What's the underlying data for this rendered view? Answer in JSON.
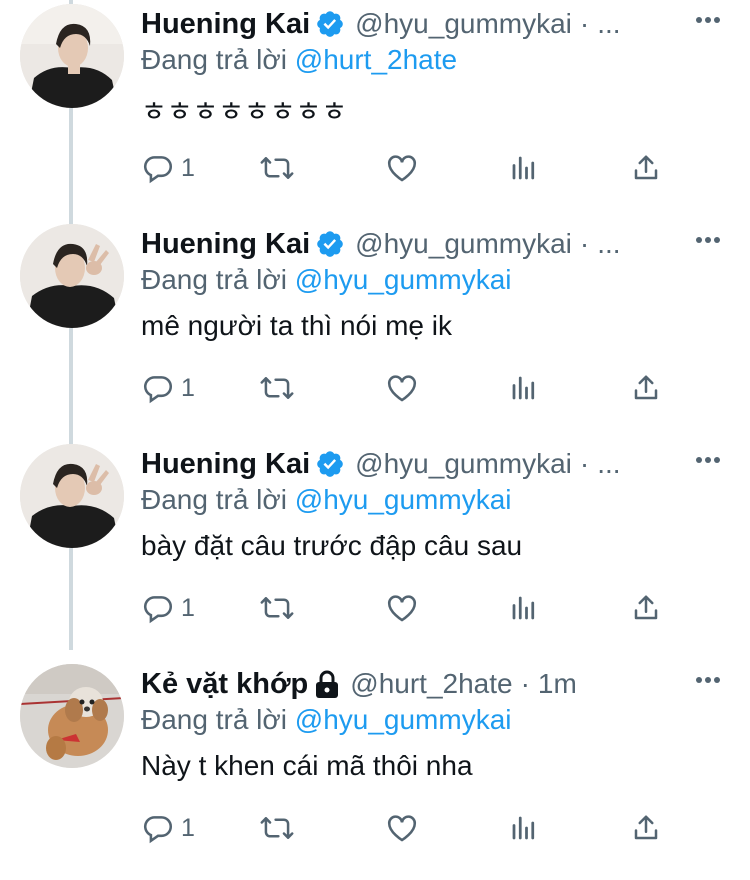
{
  "colors": {
    "accent": "#1d9bf0",
    "secondary_text": "#536471",
    "primary_text": "#0f1419",
    "thread_line": "#cfd9de"
  },
  "tweets": [
    {
      "name": "Huening Kai",
      "verified": true,
      "handle": "@hyu_gummykai",
      "separator": "·",
      "overflow": "...",
      "replying_prefix": "Đang trả lời",
      "replying_to": "@hurt_2hate",
      "text": "ㅎㅎㅎㅎㅎㅎㅎㅎ",
      "reply_count": "1",
      "icons": [
        "reply-icon",
        "retweet-icon",
        "like-icon",
        "analytics-icon",
        "share-icon",
        "more-icon"
      ]
    },
    {
      "name": "Huening Kai",
      "verified": true,
      "handle": "@hyu_gummykai",
      "separator": "·",
      "overflow": "...",
      "replying_prefix": "Đang trả lời",
      "replying_to": "@hyu_gummykai",
      "text": "mê người ta thì nói mẹ ik",
      "reply_count": "1"
    },
    {
      "name": "Huening Kai",
      "verified": true,
      "handle": "@hyu_gummykai",
      "separator": "·",
      "overflow": "...",
      "replying_prefix": "Đang trả lời",
      "replying_to": "@hyu_gummykai",
      "text": "bày đặt câu trước đập câu sau",
      "reply_count": "1"
    },
    {
      "name": "Kẻ vặt khớp",
      "locked": true,
      "handle": "@hurt_2hate",
      "separator": "·",
      "time": "1m",
      "replying_prefix": "Đang trả lời",
      "replying_to": "@hyu_gummykai",
      "text": "Này t khen cái mã thôi nha",
      "reply_count": "1"
    }
  ]
}
